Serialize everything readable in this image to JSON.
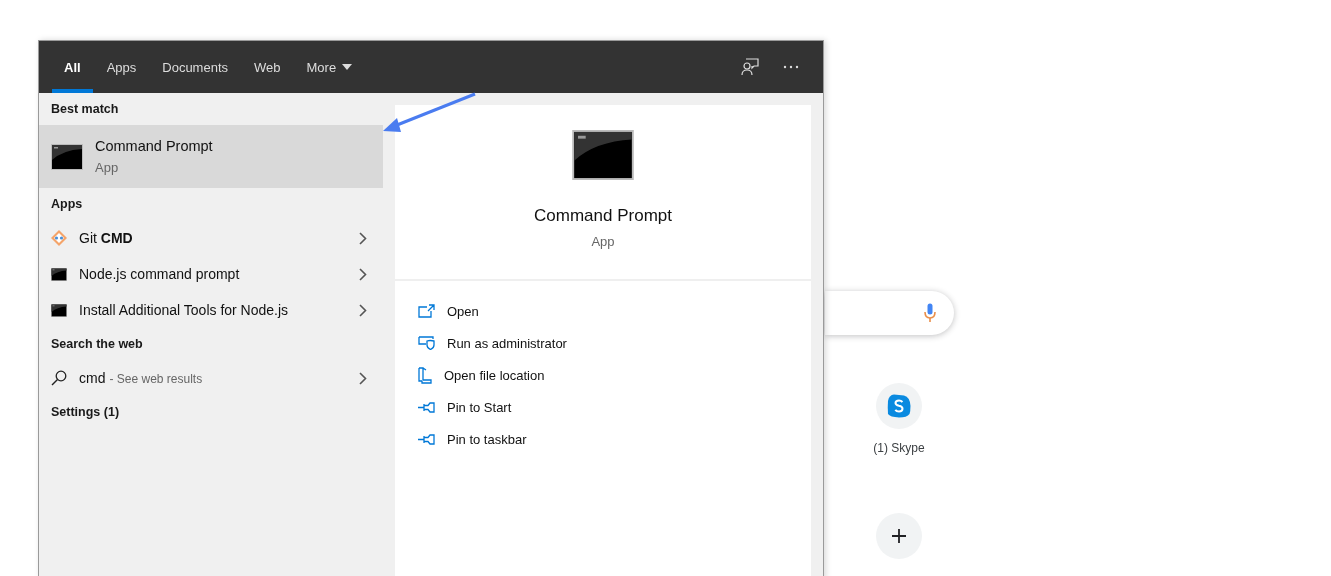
{
  "tabs": [
    {
      "label": "All",
      "selected": true,
      "kind": "plain"
    },
    {
      "label": "Apps",
      "selected": false,
      "kind": "plain"
    },
    {
      "label": "Documents",
      "selected": false,
      "kind": "plain"
    },
    {
      "label": "Web",
      "selected": false,
      "kind": "plain"
    },
    {
      "label": "More",
      "selected": false,
      "kind": "dropdown"
    }
  ],
  "sections": [
    {
      "heading": "Best match",
      "items": [
        {
          "kind": "app_large",
          "title": "Command Prompt",
          "subtitle": "App",
          "selected": true
        }
      ]
    },
    {
      "heading": "Apps",
      "items": [
        {
          "kind": "git",
          "title": "Git **CMD**",
          "selected": false
        },
        {
          "kind": "console",
          "title": "Node.js command prompt",
          "selected": false
        },
        {
          "kind": "console",
          "title": "Install Additional Tools for Node.js",
          "selected": false
        }
      ]
    },
    {
      "heading": "Search the web",
      "items": [
        {
          "kind": "web",
          "title": "cmd",
          "hint": "- See web results",
          "selected": false
        }
      ]
    },
    {
      "heading": "Settings (1)"
    }
  ],
  "preview": {
    "title": "Command Prompt",
    "subtitle": "App",
    "actions": [
      {
        "kind": "open",
        "label": "Open"
      },
      {
        "kind": "admin",
        "label": "Run as administrator"
      },
      {
        "kind": "folder",
        "label": "Open file location"
      },
      {
        "kind": "pin",
        "label": "Pin to Start"
      },
      {
        "kind": "pin",
        "label": "Pin to taskbar"
      }
    ]
  },
  "background": {
    "shortcuts": [
      {
        "kind": "skype",
        "label": "(1) Skype"
      },
      {
        "kind": "add"
      }
    ]
  }
}
